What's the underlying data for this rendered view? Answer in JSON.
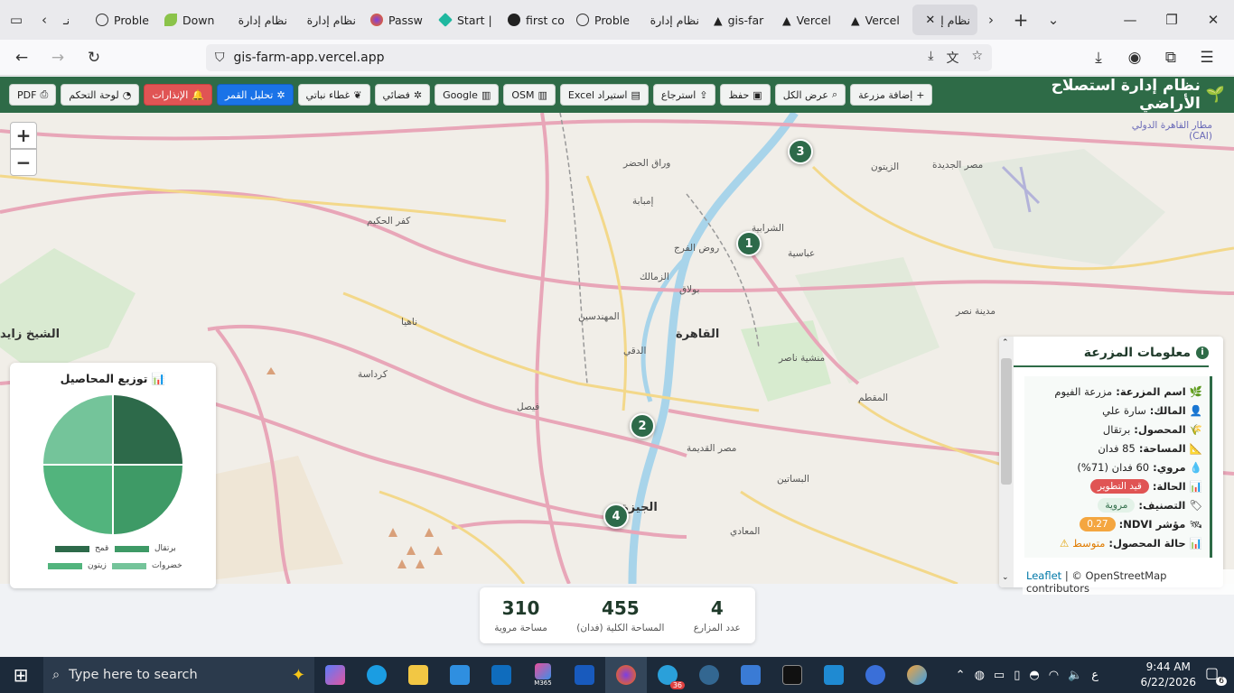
{
  "browser": {
    "tabs": [
      {
        "label": "نـ",
        "icon": "page-icon",
        "active": false
      },
      {
        "label": "Proble",
        "icon": "info-icon",
        "active": false
      },
      {
        "label": "Down",
        "icon": "leaf-icon",
        "active": false
      },
      {
        "label": "نظام إدارة",
        "icon": "page-icon",
        "active": false
      },
      {
        "label": "نظام إدارة",
        "icon": "page-icon",
        "active": false
      },
      {
        "label": "Passw",
        "icon": "firefox-icon",
        "active": false
      },
      {
        "label": "Start |",
        "icon": "diamond-icon",
        "active": false
      },
      {
        "label": "first co",
        "icon": "github-icon",
        "active": false
      },
      {
        "label": "Proble",
        "icon": "info-icon",
        "active": false
      },
      {
        "label": "نظام إدارة",
        "icon": "page-icon",
        "active": false
      },
      {
        "label": "gis-far",
        "icon": "vercel-icon",
        "active": false
      },
      {
        "label": "Vercel",
        "icon": "vercel-icon",
        "active": false
      },
      {
        "label": "Vercel",
        "icon": "vercel-icon",
        "active": false
      },
      {
        "label": "نظام إ",
        "icon": "page-icon",
        "active": true
      }
    ],
    "url": "gis-farm-app.vercel.app"
  },
  "app": {
    "title": "نظام إدارة استصلاح الأراضي",
    "buttons": {
      "add_farm": "إضافة مزرعة",
      "show_all": "عرض الكل",
      "save": "حفظ",
      "restore": "استرجاع",
      "import_excel": "استيراد Excel",
      "osm": "OSM",
      "google": "Google",
      "satellite": "فضائي",
      "vegetation": "غطاء نباتي",
      "moon_analysis": "تحليل القمر",
      "alerts": "الإنذارات",
      "dashboard": "لوحة التحكم",
      "pdf": "PDF"
    }
  },
  "map": {
    "zoom_in": "+",
    "zoom_out": "−",
    "markers": [
      "1",
      "2",
      "3",
      "4"
    ],
    "places": {
      "cairo": "القاهرة",
      "zamalek": "الزمالك",
      "giza": "الجيزة",
      "mohandessin": "المهندسين",
      "dokki": "الدقي",
      "shubra": "الشرابية",
      "imbaba": "إمبابة",
      "heliopolis": "مصر الجديدة",
      "nasr_city": "مدينة نصر",
      "maadi": "المعادي",
      "zaitoun": "الزيتون",
      "airport": "مطار القاهرة الدولي (CAI)",
      "abbasia": "عباسية",
      "bulaq": "بولاق",
      "rod_elfarag": "روض الفرج",
      "warraq": "وراق الحضر",
      "kerdasa": "كرداسة",
      "sheikh_zayed": "الشيخ زايد",
      "manshiet_nasser": "منشية ناصر",
      "old_cairo": "مصر القديمة",
      "basatin": "البساتين",
      "nahia": "ناهيا",
      "kafr_hakim": "كفر الحكيم",
      "mokattam": "المقطم",
      "faisal": "فيصل"
    }
  },
  "farm_info": {
    "title": "معلومات المزرعة",
    "name_label": "اسم المزرعة:",
    "name": "مزرعة الفيوم",
    "owner_label": "المالك:",
    "owner": "سارة علي",
    "crop_label": "المحصول:",
    "crop": "برتقال",
    "area_label": "المساحة:",
    "area": "85 فدان",
    "irrigated_label": "مروي:",
    "irrigated": "60 فدان (71%)",
    "status_label": "الحالة:",
    "status": "قيد التطوير",
    "class_label": "التصنيف:",
    "class": "مروية",
    "ndvi_label": "مؤشر NDVI:",
    "ndvi": "0.27",
    "health_label": "حالة المحصول:",
    "health": "متوسط"
  },
  "attribution": {
    "leaflet": "Leaflet",
    "osm": "| © OpenStreetMap contributors"
  },
  "chart": {
    "title": "توزيع المحاصيل",
    "legend": [
      {
        "label": "قمح",
        "color": "#2d6a4a"
      },
      {
        "label": "برتقال",
        "color": "#3e9a66"
      },
      {
        "label": "زيتون",
        "color": "#52b47d"
      },
      {
        "label": "خضروات",
        "color": "#74c49a"
      }
    ]
  },
  "chart_data": {
    "type": "pie",
    "title": "توزيع المحاصيل",
    "categories": [
      "قمح",
      "برتقال",
      "زيتون",
      "خضروات"
    ],
    "values": [
      1,
      1,
      1,
      1
    ],
    "colors": [
      "#2d6a4a",
      "#3e9a66",
      "#52b47d",
      "#74c49a"
    ]
  },
  "stats": {
    "farms_count": "4",
    "farms_label": "عدد المزارع",
    "total_area": "455",
    "total_area_label": "المساحة الكلية (فدان)",
    "irrigated_area": "310",
    "irrigated_area_label": "مساحة مروية"
  },
  "taskbar": {
    "search_placeholder": "Type here to search",
    "time": "9:44 AM",
    "date": "6/22/2026",
    "lang": "ع",
    "notifications": "6",
    "telegram_badge": "36",
    "m365_label": "M365"
  }
}
